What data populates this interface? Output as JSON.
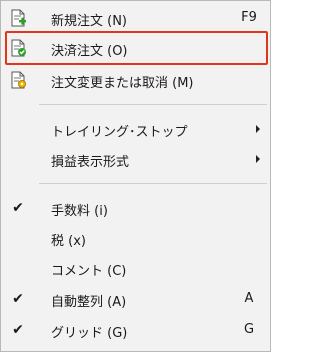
{
  "menu": {
    "items": [
      {
        "label": "新規注文 (N)",
        "shortcut": "F9",
        "icon": "new-order-icon"
      },
      {
        "label": "決済注文 (O)",
        "icon": "settle-order-icon"
      },
      {
        "label": "注文変更または取消 (M)",
        "icon": "modify-order-icon"
      },
      {
        "label": "トレイリング･ストップ",
        "submenu": true
      },
      {
        "label": "損益表示形式",
        "submenu": true
      },
      {
        "label": "手数料 (i)",
        "checked": true
      },
      {
        "label": "税 (x)",
        "checked": false
      },
      {
        "label": "コメント (C)",
        "checked": false
      },
      {
        "label": "自動整列 (A)",
        "shortcut": "A",
        "checked": true
      },
      {
        "label": "グリッド (G)",
        "shortcut": "G",
        "checked": true
      }
    ],
    "check_glyph": "✔",
    "highlight_color": "#e2351d"
  }
}
